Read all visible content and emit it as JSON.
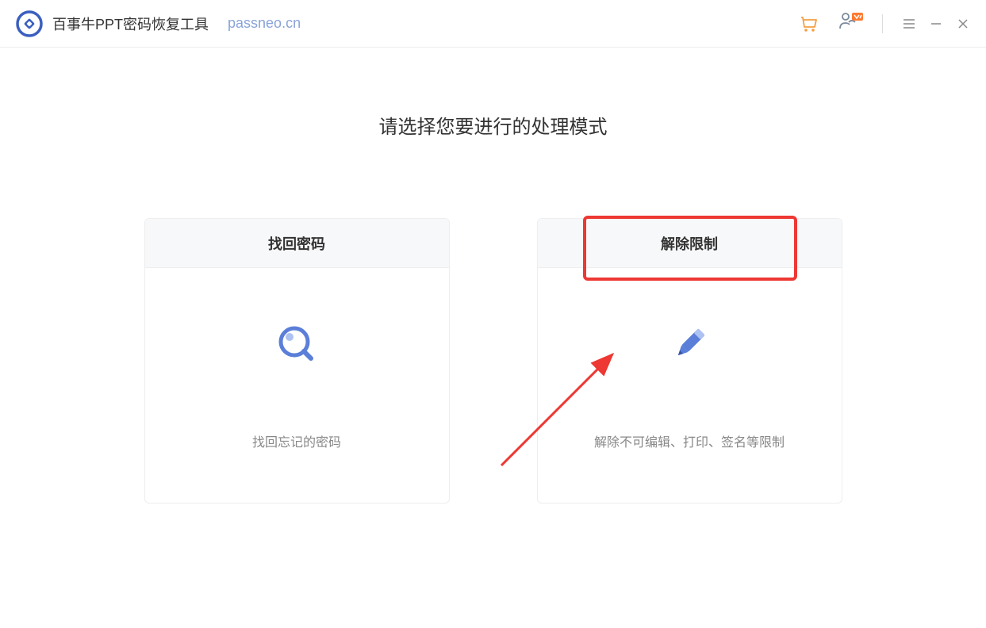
{
  "header": {
    "app_title": "百事牛PPT密码恢复工具",
    "domain": "passneo.cn"
  },
  "main": {
    "prompt_title": "请选择您要进行的处理模式",
    "cards": [
      {
        "title": "找回密码",
        "description": "找回忘记的密码"
      },
      {
        "title": "解除限制",
        "description": "解除不可编辑、打印、签名等限制"
      }
    ]
  }
}
